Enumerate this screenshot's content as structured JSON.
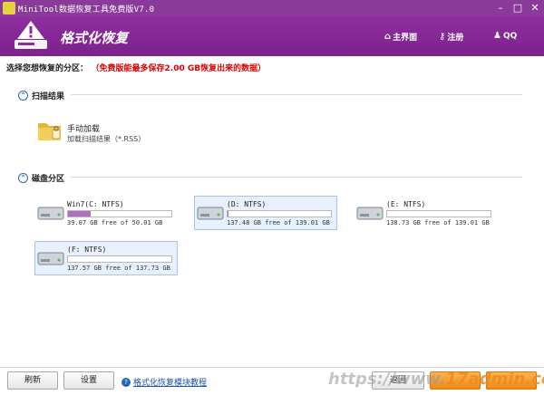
{
  "window": {
    "title": "MiniTool数据恢复工具免费版V7.0",
    "controls": {
      "minimize": "–",
      "maximize": "□",
      "close": "✕"
    }
  },
  "header": {
    "title": "格式化恢复",
    "nav": [
      {
        "icon": "home-icon",
        "glyph": "⌂",
        "label": "主界面"
      },
      {
        "icon": "key-icon",
        "glyph": "⚷",
        "label": "注册"
      },
      {
        "icon": "qq-icon",
        "glyph": "♟",
        "label": "QQ"
      }
    ]
  },
  "prompt": {
    "label": "选择您想恢复的分区：",
    "hint": "（免费版能最多保存2.00 GB恢复出来的数据）"
  },
  "scan_section": {
    "title": "扫描结果",
    "toggle": "⌃",
    "item": {
      "name": "手动加载",
      "desc": "加载扫描结果（*.RSS）"
    }
  },
  "disk_section": {
    "title": "磁盘分区",
    "toggle": "⌃",
    "partitions": [
      {
        "name": "Win7(C: NTFS)",
        "free_text": "39.07 GB free of 50.01 GB",
        "used_fraction": 0.22,
        "selected": false
      },
      {
        "name": "(D: NTFS)",
        "free_text": "137.48 GB free of 139.01 GB",
        "used_fraction": 0.01,
        "selected": true
      },
      {
        "name": "(E: NTFS)",
        "free_text": "138.73 GB free of 139.01 GB",
        "used_fraction": 0.0,
        "selected": false
      },
      {
        "name": "(F: NTFS)",
        "free_text": "137.57 GB free of 137.73 GB",
        "used_fraction": 0.0,
        "selected": true
      }
    ]
  },
  "footer": {
    "refresh": "刷新",
    "settings": "设置",
    "tutorial": "格式化恢复模块教程",
    "back": "返回",
    "next": "",
    "close_btn": ""
  },
  "watermark": {
    "prefix": "https://www.",
    "domain": "17admin.cc"
  },
  "colors": {
    "brand": "#8a2d9c",
    "progress": "#b070c0",
    "warning": "#e00000",
    "link": "#1a4fb0"
  }
}
